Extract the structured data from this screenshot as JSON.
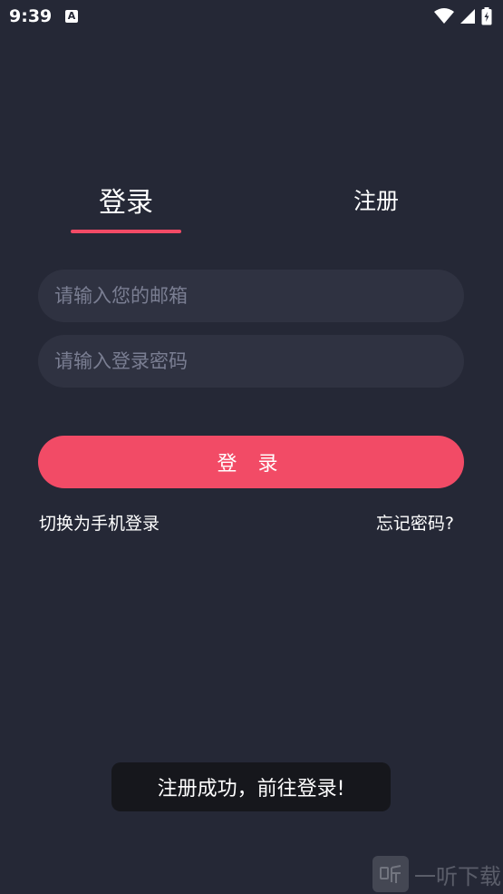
{
  "status_bar": {
    "time": "9:39",
    "notification_icon_letter": "A"
  },
  "tabs": {
    "login_label": "登录",
    "register_label": "注册",
    "active": "login",
    "indicator_color": "#f24b66"
  },
  "form": {
    "email_placeholder": "请输入您的邮箱",
    "email_value": "",
    "password_placeholder": "请输入登录密码",
    "password_value": "",
    "login_button_label": "登 录",
    "accent_color": "#f24b66"
  },
  "links": {
    "switch_phone_label": "切换为手机登录",
    "forgot_password_label": "忘记密码?"
  },
  "toast": {
    "message": "注册成功，前往登录!"
  },
  "watermark": {
    "text": "一听下载"
  }
}
